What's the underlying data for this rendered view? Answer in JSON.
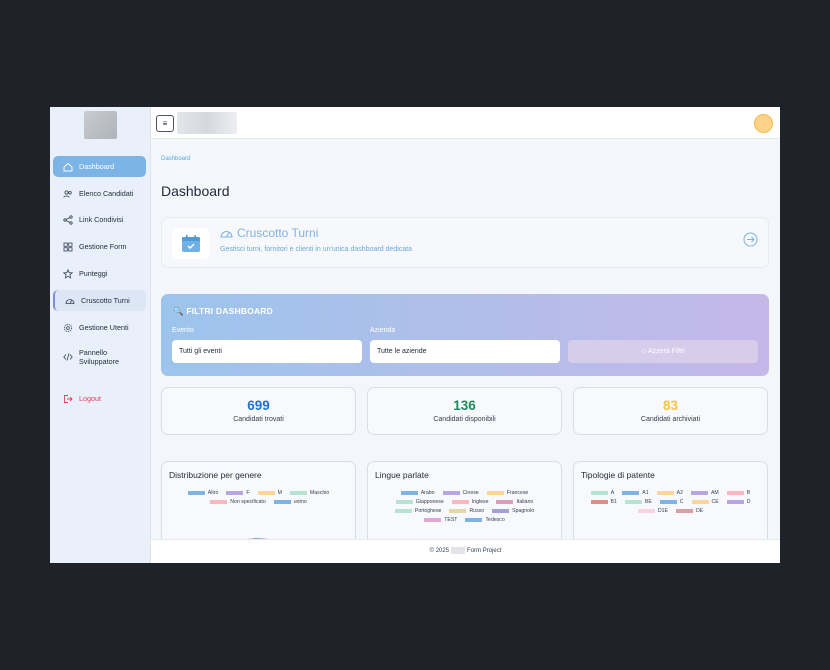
{
  "sidebar": {
    "items": [
      {
        "label": "Dashboard",
        "icon": "home-icon"
      },
      {
        "label": "Elenco Candidati",
        "icon": "users-icon"
      },
      {
        "label": "Link Condivisi",
        "icon": "share-icon"
      },
      {
        "label": "Gestione Form",
        "icon": "grid-icon"
      },
      {
        "label": "Punteggi",
        "icon": "star-icon"
      },
      {
        "label": "Cruscotto Turni",
        "icon": "gauge-icon"
      },
      {
        "label": "Gestione Utenti",
        "icon": "gear-icon"
      },
      {
        "label": "Pannello Sviluppatore",
        "icon": "code-icon"
      },
      {
        "label": "Logout",
        "icon": "logout-icon"
      }
    ]
  },
  "topbar": {
    "menu_glyph": "≡"
  },
  "breadcrumb": "Dashboard",
  "page_title": "Dashboard",
  "cruscotto": {
    "title": "Cruscotto Turni",
    "description": "Gestisci turni, fornitori e clienti in un'unica dashboard dedicata"
  },
  "filters": {
    "title": "🔍 FILTRI DASHBOARD",
    "evento_label": "Evento",
    "evento_value": "Tutti gli eventi",
    "azienda_label": "Azienda",
    "azienda_value": "Tutte le aziende",
    "reset_label": "◇ Azzera Filtri"
  },
  "stats": [
    {
      "value": "699",
      "label": "Candidati trovati",
      "color": "#1d74d6"
    },
    {
      "value": "136",
      "label": "Candidati disponibili",
      "color": "#1f8a5b"
    },
    {
      "value": "83",
      "label": "Candidati archiviati",
      "color": "#f5c542"
    }
  ],
  "charts": [
    {
      "title": "Distribuzione per genere",
      "legend": [
        {
          "label": "Altro",
          "color": "#7fb3e3"
        },
        {
          "label": "F",
          "color": "#b6a6e6"
        },
        {
          "label": "M",
          "color": "#fdd3a0"
        },
        {
          "label": "Maschio",
          "color": "#b7e4d2"
        },
        {
          "label": "Non specificato",
          "color": "#f9b8c0"
        },
        {
          "label": "uomo",
          "color": "#7fb3e3"
        }
      ]
    },
    {
      "title": "Lingue parlate",
      "legend": [
        {
          "label": "Arabo",
          "color": "#7fb3e3"
        },
        {
          "label": "Cinese",
          "color": "#b6a6e6"
        },
        {
          "label": "Francese",
          "color": "#fdd3a0"
        },
        {
          "label": "Giapponese",
          "color": "#b7e4d2"
        },
        {
          "label": "Inglese",
          "color": "#f9b8c0"
        },
        {
          "label": "Italiano",
          "color": "#d8a0b8"
        },
        {
          "label": "Portoghese",
          "color": "#b7e4d2"
        },
        {
          "label": "Russo",
          "color": "#e6d7a0"
        },
        {
          "label": "Spagnolo",
          "color": "#a6a0d8"
        },
        {
          "label": "TEST",
          "color": "#e0a8d8"
        },
        {
          "label": "Tedesco",
          "color": "#7fb3e3"
        }
      ]
    },
    {
      "title": "Tipologie di patente",
      "legend": [
        {
          "label": "A",
          "color": "#b7e4d2"
        },
        {
          "label": "A1",
          "color": "#7fb3e3"
        },
        {
          "label": "A2",
          "color": "#fdd3a0"
        },
        {
          "label": "AM",
          "color": "#b6a6e6"
        },
        {
          "label": "B",
          "color": "#f9b8c0"
        },
        {
          "label": "B1",
          "color": "#e08a8a"
        },
        {
          "label": "BE",
          "color": "#b7e4d2"
        },
        {
          "label": "C",
          "color": "#7fb3e3"
        },
        {
          "label": "CE",
          "color": "#fdd3a0"
        },
        {
          "label": "D",
          "color": "#b6a6e6"
        },
        {
          "label": "D1E",
          "color": "#f9d4e0"
        },
        {
          "label": "DE",
          "color": "#d8a0a0"
        }
      ]
    }
  ],
  "footer": {
    "prefix": "© 2025",
    "suffix": "Form Project"
  }
}
